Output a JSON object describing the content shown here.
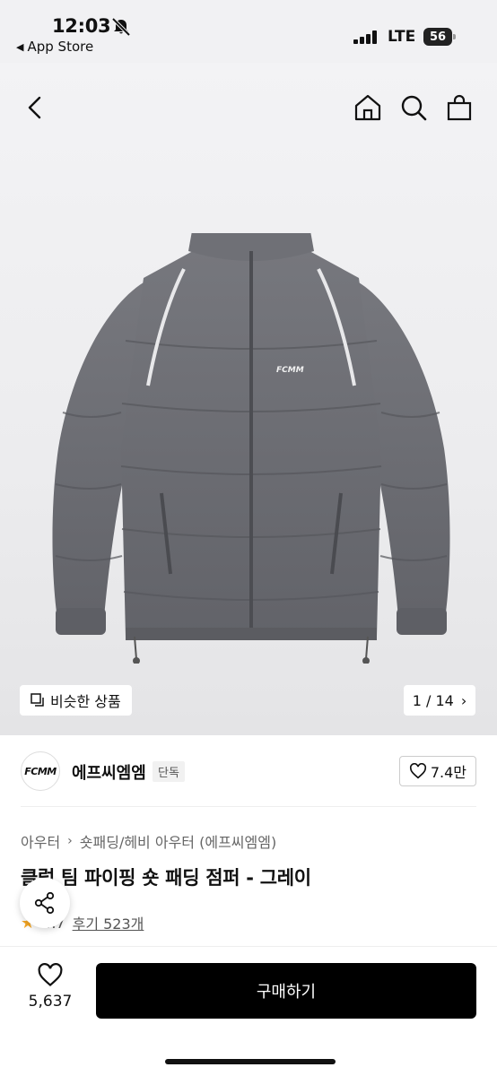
{
  "status_bar": {
    "time": "12:03",
    "back_app": "App Store",
    "network": "LTE",
    "battery": "56"
  },
  "nav": {
    "icons": [
      "back-icon",
      "home-icon",
      "search-icon",
      "bag-icon"
    ]
  },
  "gallery": {
    "similar_label": "비슷한 상품",
    "page_counter": "1 / 14",
    "jacket_logo": "FCMM"
  },
  "brand": {
    "logo_text": "FCMM",
    "name": "에프씨엠엠",
    "badge": "단독",
    "likes": "7.4만"
  },
  "product": {
    "breadcrumb": [
      "아우터",
      "숏패딩/헤비 아우터 (에프씨엠엠)"
    ],
    "title": "클럽 팀 파이핑 숏 패딩 점퍼 - 그레이",
    "rating": "4.7",
    "reviews": "후기 523개"
  },
  "bottom": {
    "wish_count": "5,637",
    "buy_label": "구매하기"
  },
  "colors": {
    "accent": "#000000",
    "star": "#f5a623",
    "jacket": "#6b6c72"
  }
}
